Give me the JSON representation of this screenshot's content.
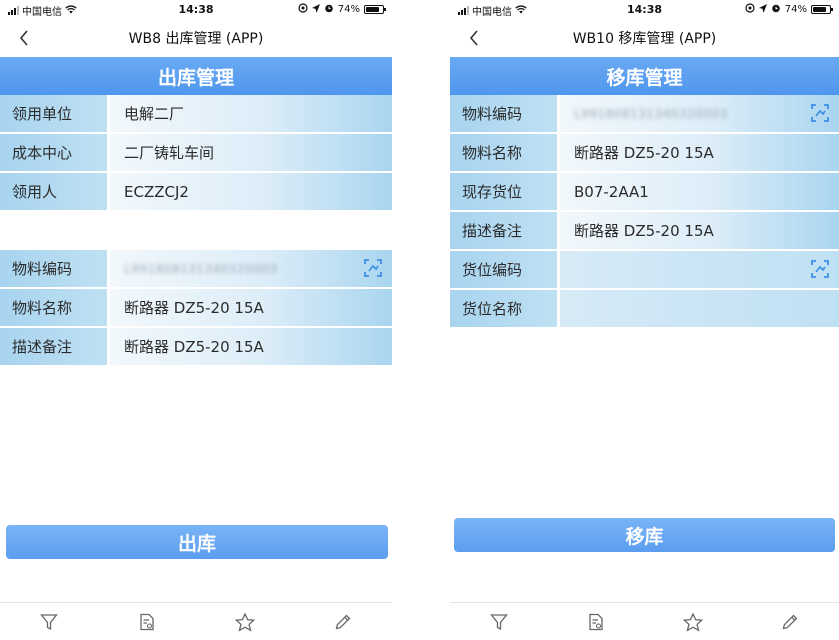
{
  "status_bar": {
    "carrier": "中国电信",
    "time": "14:38",
    "battery": "74%",
    "battery_level": 0.74
  },
  "left_screen": {
    "nav_title": "WB8 出库管理 (APP)",
    "section_title": "出库管理",
    "header_fields": [
      {
        "label": "领用单位",
        "value": "电解二厂"
      },
      {
        "label": "成本中心",
        "value": "二厂铸轧车间"
      },
      {
        "label": "领用人",
        "value": "ECZZCJ2"
      }
    ],
    "material_fields": [
      {
        "label": "物料编码",
        "value": "L991808131340320003",
        "blurred": true,
        "scan": true
      },
      {
        "label": "物料名称",
        "value": "断路器 DZ5-20 15A"
      },
      {
        "label": "描述备注",
        "value": "断路器 DZ5-20 15A"
      }
    ],
    "action_button": "出库"
  },
  "right_screen": {
    "nav_title": "WB10 移库管理 (APP)",
    "section_title": "移库管理",
    "fields": [
      {
        "label": "物料编码",
        "value": "L991808131340320003",
        "blurred": true,
        "scan": true
      },
      {
        "label": "物料名称",
        "value": "断路器 DZ5-20 15A"
      },
      {
        "label": "现存货位",
        "value": "B07-2AA1"
      },
      {
        "label": "描述备注",
        "value": "断路器 DZ5-20 15A"
      },
      {
        "label": "货位编码",
        "value": "",
        "scan": true
      },
      {
        "label": "货位名称",
        "value": ""
      }
    ],
    "action_button": "移库"
  },
  "tab_bar": {
    "icons": [
      "filter-icon",
      "document-icon",
      "star-icon",
      "pencil-icon"
    ]
  },
  "colors": {
    "header_blue": "#5b9ef0",
    "label_blue": "#b3daf1",
    "scan_icon_blue": "#3d8fe6"
  }
}
